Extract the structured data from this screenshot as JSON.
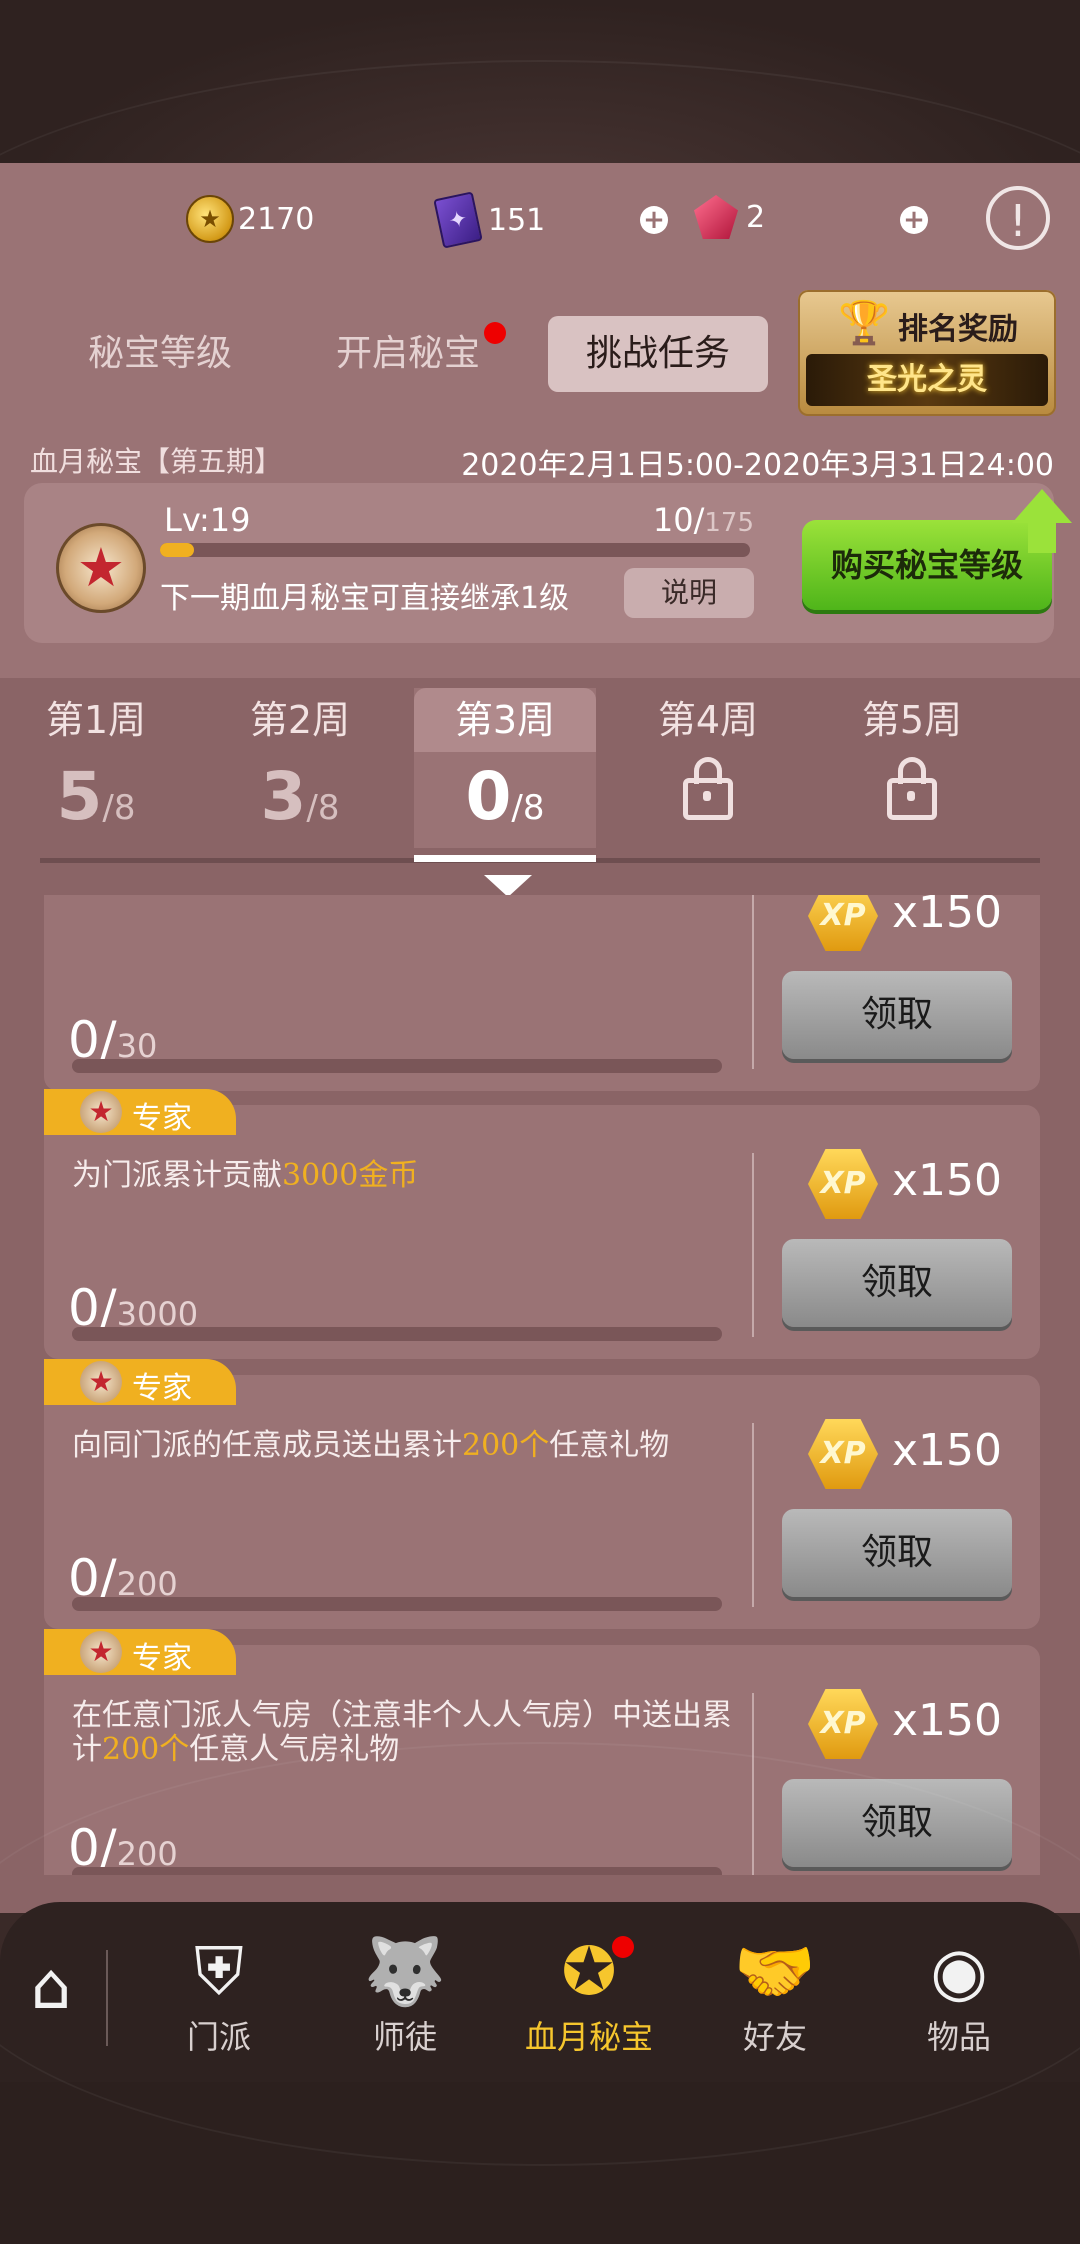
{
  "currency": {
    "gold": "2170",
    "book": "151",
    "gem": "2"
  },
  "tabs": [
    {
      "label": "秘宝等级"
    },
    {
      "label": "开启秘宝"
    },
    {
      "label": "挑战任务"
    }
  ],
  "rank": {
    "title": "排名奖励",
    "banner": "圣光之灵"
  },
  "season": {
    "title": "血月秘宝【第五期】",
    "date": "2020年2月1日5:00-2020年3月31日24:00"
  },
  "level": {
    "lv": "Lv:19",
    "current": "10/",
    "total": "175",
    "progress": 0.057,
    "note": "下一期血月秘宝可直接继承1级",
    "explain": "说明",
    "buy": "购买秘宝等级"
  },
  "weeks": [
    {
      "label": "第1周",
      "done": "5",
      "total": "/8",
      "locked": false
    },
    {
      "label": "第2周",
      "done": "3",
      "total": "/8",
      "locked": false
    },
    {
      "label": "第3周",
      "done": "0",
      "total": "/8",
      "locked": false
    },
    {
      "label": "第4周",
      "locked": true
    },
    {
      "label": "第5周",
      "locked": true
    }
  ],
  "tasks": [
    {
      "badge": "",
      "desc_a": "",
      "desc_hl": "",
      "desc_b": "",
      "current": "0/",
      "target": "30",
      "reward_icon": "XP",
      "reward": "x150",
      "button": "领取"
    },
    {
      "badge": "专家",
      "desc_a": "为门派累计贡献",
      "desc_hl": "3000金币",
      "desc_b": "",
      "current": "0/",
      "target": "3000",
      "reward_icon": "XP",
      "reward": "x150",
      "button": "领取"
    },
    {
      "badge": "专家",
      "desc_a": "向同门派的任意成员送出累计",
      "desc_hl": "200个",
      "desc_b": "任意礼物",
      "current": "0/",
      "target": "200",
      "reward_icon": "XP",
      "reward": "x150",
      "button": "领取"
    },
    {
      "badge": "专家",
      "desc_a": "在任意门派人气房（注意非个人人气房）中送出累计",
      "desc_hl": "200个",
      "desc_b": "任意人气房礼物",
      "current": "0/",
      "target": "200",
      "reward_icon": "XP",
      "reward": "x150",
      "button": "领取"
    }
  ],
  "nav": [
    {
      "label": "门派",
      "icon": "shield-icon"
    },
    {
      "label": "师徒",
      "icon": "wolf-icon"
    },
    {
      "label": "血月秘宝",
      "icon": "compass-icon"
    },
    {
      "label": "好友",
      "icon": "handshake-icon"
    },
    {
      "label": "物品",
      "icon": "bag-icon"
    }
  ]
}
